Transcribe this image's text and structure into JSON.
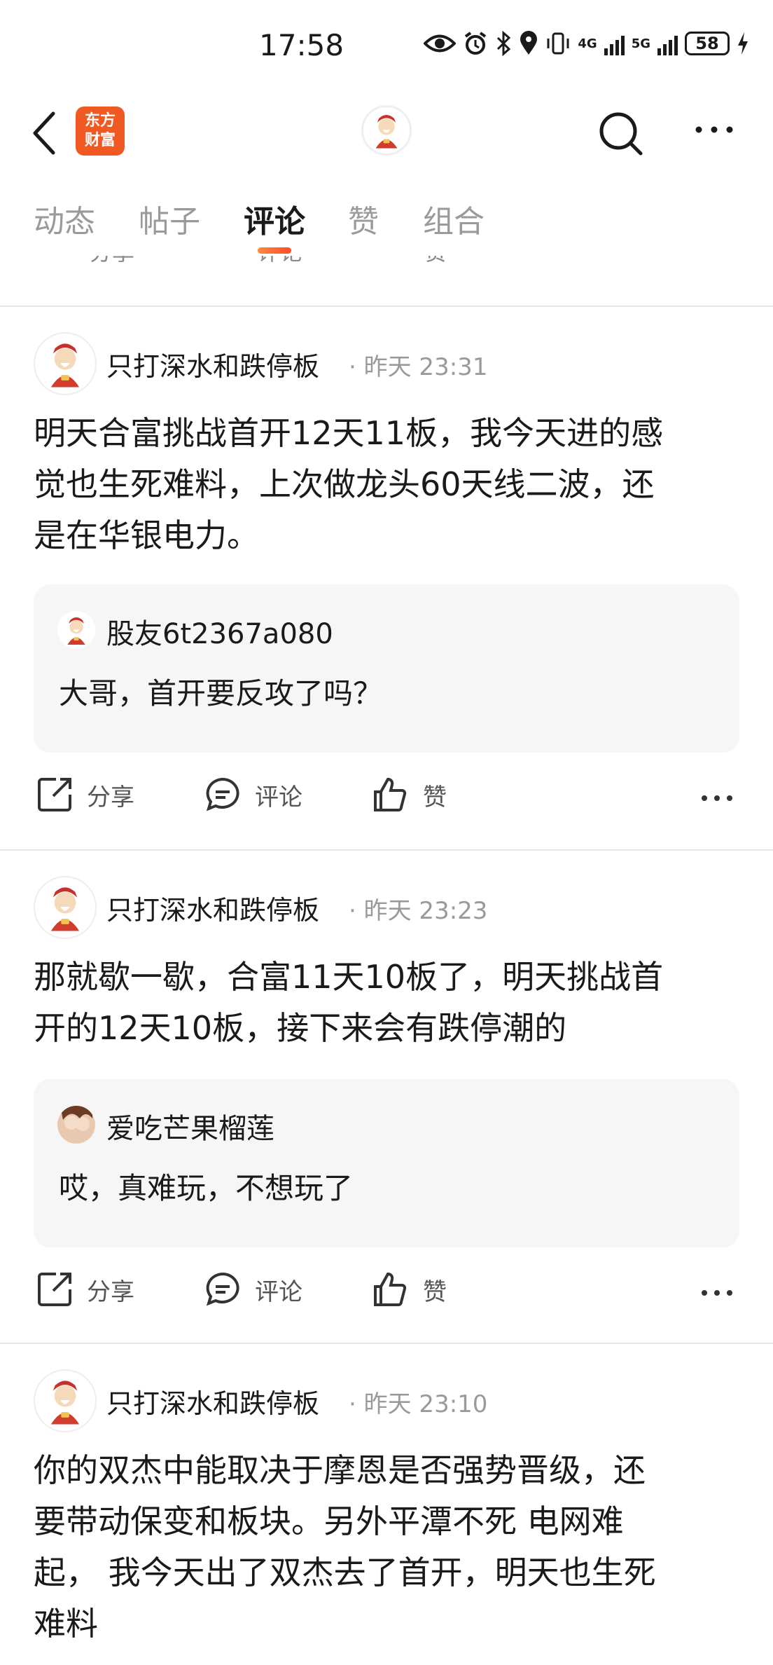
{
  "status": {
    "time": "17:58",
    "battery": "58",
    "net1": "4G",
    "net2": "5G"
  },
  "header": {
    "logo_line1": "东方",
    "logo_line2": "财富"
  },
  "tabs": [
    "动态",
    "帖子",
    "评论",
    "赞",
    "组合"
  ],
  "actions": {
    "share": "分享",
    "comment": "评论",
    "like": "赞"
  },
  "posts": [
    {
      "author": "只打深水和跌停板",
      "dot": "·",
      "time": "昨天 23:31",
      "lines": [
        "明天合富挑战首开12天11板，我今天进的感",
        "觉也生死难料，上次做龙头60天线二波，还",
        "是在华银电力。"
      ],
      "reply": {
        "name": "股友6t2367a080",
        "text": "大哥，首开要反攻了吗？"
      }
    },
    {
      "author": "只打深水和跌停板",
      "dot": "·",
      "time": "昨天 23:23",
      "lines": [
        "那就歇一歇，合富11天10板了，明天挑战首",
        "开的12天10板，接下来会有跌停潮的"
      ],
      "reply": {
        "name": "爱吃芒果榴莲",
        "text": "哎，真难玩，不想玩了"
      }
    },
    {
      "author": "只打深水和跌停板",
      "dot": "·",
      "time": "昨天 23:10",
      "lines": [
        "你的双杰中能取决于摩恩是否强势晋级，还",
        "要带动保变和板块。另外平潭不死 电网难",
        "起， 我今天出了双杰去了首开，明天也生死",
        "难料"
      ]
    }
  ]
}
